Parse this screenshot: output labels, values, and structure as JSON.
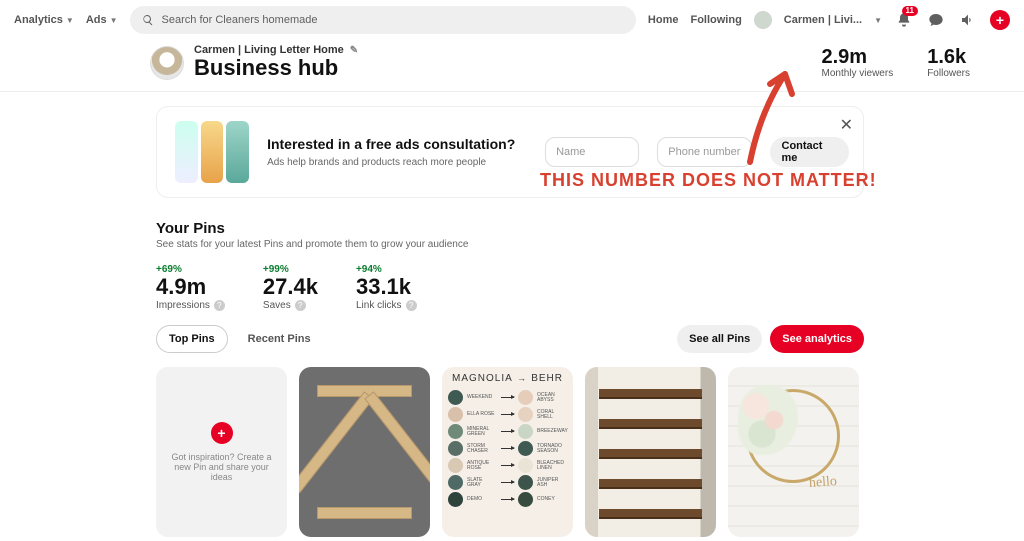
{
  "nav": {
    "analytics": "Analytics",
    "ads": "Ads",
    "search_placeholder": "Search for Cleaners homemade",
    "home": "Home",
    "following": "Following",
    "user_short": "Carmen | Livi...",
    "notif_count": "11"
  },
  "profile": {
    "name": "Carmen | Living Letter Home",
    "title": "Business hub"
  },
  "header_stats": {
    "viewers_val": "2.9m",
    "viewers_lbl": "Monthly viewers",
    "followers_val": "1.6k",
    "followers_lbl": "Followers"
  },
  "promo": {
    "heading": "Interested in a free ads consultation?",
    "sub": "Ads help brands and products reach more people",
    "name_ph": "Name",
    "phone_ph": "Phone number",
    "contact": "Contact me"
  },
  "yourpins": {
    "title": "Your Pins",
    "sub": "See stats for your latest Pins and promote them to grow your audience"
  },
  "stats": [
    {
      "delta": "+69%",
      "val": "4.9m",
      "lbl": "Impressions"
    },
    {
      "delta": "+99%",
      "val": "27.4k",
      "lbl": "Saves"
    },
    {
      "delta": "+94%",
      "val": "33.1k",
      "lbl": "Link clicks"
    }
  ],
  "tabs": {
    "top": "Top Pins",
    "recent": "Recent Pins",
    "seeall": "See all Pins",
    "analytics": "See analytics"
  },
  "create": {
    "text": "Got inspiration? Create a new Pin and share your ideas"
  },
  "pin3": {
    "left": "MAGNOLIA",
    "right": "BEHR",
    "rows": [
      {
        "c1": "#3f5a52",
        "l1": "WEEKEND",
        "c2": "#e6cdb9",
        "l2": "OCEAN ABYSS"
      },
      {
        "c1": "#d9c0aa",
        "l1": "ELLA ROSE",
        "c2": "#e7d2c0",
        "l2": "CORAL SHELL"
      },
      {
        "c1": "#6f8a78",
        "l1": "MINERAL GREEN",
        "c2": "#c9d6c6",
        "l2": "BREEZEWAY"
      },
      {
        "c1": "#5a6e68",
        "l1": "STORM CHASER",
        "c2": "#3f5a52",
        "l2": "TORNADO SEASON"
      },
      {
        "c1": "#d8c8b4",
        "l1": "ANTIQUE ROSE",
        "c2": "#eae4d6",
        "l2": "BLEACHED LINEN"
      },
      {
        "c1": "#4f6a66",
        "l1": "SLATE GRAY",
        "c2": "#3d544c",
        "l2": "JUNIPER ASH"
      },
      {
        "c1": "#2f433d",
        "l1": "DEMO",
        "c2": "#374b3f",
        "l2": "CONEY"
      }
    ]
  },
  "pin5": {
    "script": "hello"
  },
  "annotation": {
    "text": "THIS NUMBER DOES NOT MATTER!"
  }
}
